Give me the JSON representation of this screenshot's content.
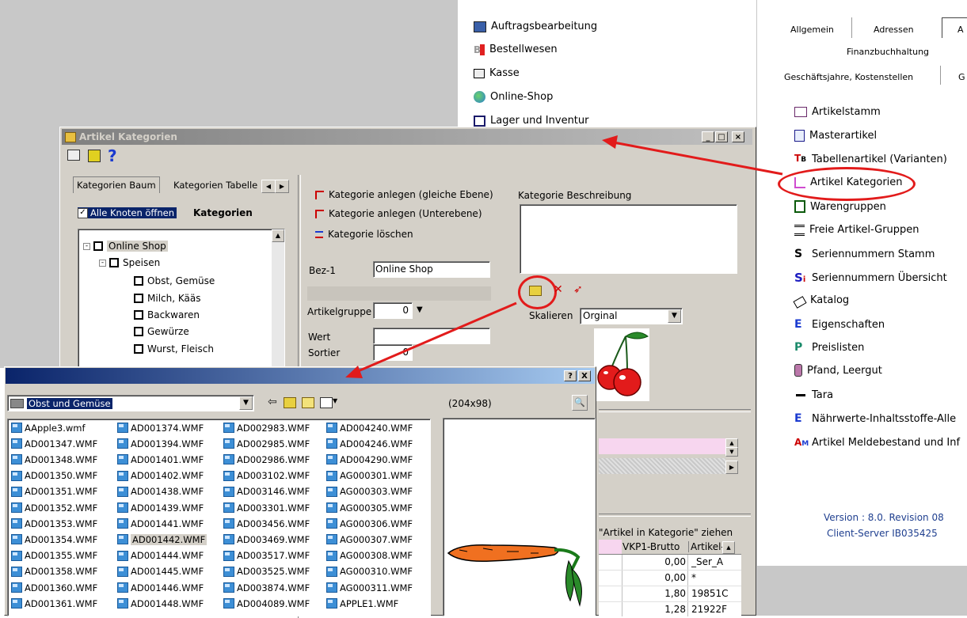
{
  "main_menu": {
    "items": [
      {
        "label": "Auftragsbearbeitung",
        "icon": "calculator-icon"
      },
      {
        "label": "Bestellwesen",
        "icon": "b-red-icon"
      },
      {
        "label": "Kasse",
        "icon": "cash-register-icon"
      },
      {
        "label": "Online-Shop",
        "icon": "globe-icon"
      },
      {
        "label": "Lager und Inventur",
        "icon": "warehouse-icon"
      }
    ]
  },
  "top_tabs": {
    "allgemein": "Allgemein",
    "adressen": "Adressen",
    "partial": "A",
    "finanz": "Finanzbuchhaltung",
    "geschaeft": "Geschäftsjahre, Kostenstellen",
    "partial2": "G"
  },
  "right_menu": {
    "items": [
      {
        "label": "Artikelstamm"
      },
      {
        "label": "Masterartikel"
      },
      {
        "label": "Tabellenartikel (Varianten)"
      },
      {
        "label": "Artikel Kategorien"
      },
      {
        "label": "Warengruppen"
      },
      {
        "label": "Freie Artikel-Gruppen"
      },
      {
        "label": "Seriennummern Stamm"
      },
      {
        "label": "Seriennummern Übersicht"
      },
      {
        "label": "Katalog"
      },
      {
        "label": "Eigenschaften"
      },
      {
        "label": "Preislisten"
      },
      {
        "label": "Pfand, Leergut"
      },
      {
        "label": "Tara"
      },
      {
        "label": "Nährwerte-Inhaltsstoffe-Alle"
      },
      {
        "label": "Artikel Meldebestand und Inf"
      }
    ],
    "version": "Version : 8.0. Revision 08",
    "server": "Client-Server  IB035425"
  },
  "kat_window": {
    "title": "Artikel Kategorien",
    "tab_baum": "Kategorien Baum",
    "tab_tabelle": "Kategorien Tabelle",
    "checkbox_label": "Alle Knoten öffnen",
    "kategorien_header": "Kategorien",
    "tree": [
      {
        "label": "Online Shop"
      },
      {
        "label": "Speisen"
      },
      {
        "label": "Obst, Gemüse"
      },
      {
        "label": "Milch, Kääs"
      },
      {
        "label": "Backwaren"
      },
      {
        "label": "Gewürze"
      },
      {
        "label": "Wurst, Fleisch"
      }
    ],
    "actions": {
      "anlegen_gleich": "Kategorie anlegen (gleiche Ebene)",
      "anlegen_unter": "Kategorie anlegen (Unterebene)",
      "loeschen": "Kategorie löschen"
    },
    "beschreibung_label": "Kategorie Beschreibung",
    "bez_label": "Bez-1",
    "bez_value": "Online Shop",
    "artikelgruppe_label": "Artikelgruppe",
    "artikelgruppe_value": "0",
    "wert_label": "Wert",
    "sortier_label": "Sortier",
    "sortier_value": "0",
    "skalieren_label": "Skalieren",
    "skalieren_value": "Orginal",
    "drag_hint": "\"Artikel in Kategorie\" ziehen",
    "grid_headers": [
      "VKP1-Brutto",
      "Artikel-I"
    ],
    "grid_rows": [
      {
        "price": "0,00",
        "code": "_Ser_A"
      },
      {
        "price": "0,00",
        "code": "*"
      },
      {
        "price": "1,80",
        "code": "19851C"
      },
      {
        "price": "1,28",
        "code": "21922F"
      }
    ]
  },
  "file_dialog": {
    "folder": "Obst und Gemüse",
    "dimensions": "(204x98)",
    "help_btn": "?",
    "close_btn": "X",
    "columns": [
      [
        "AApple3.wmf",
        "AD001347.WMF",
        "AD001348.WMF",
        "AD001350.WMF",
        "AD001351.WMF",
        "AD001352.WMF",
        "AD001353.WMF",
        "AD001354.WMF",
        "AD001355.WMF",
        "AD001358.WMF",
        "AD001360.WMF",
        "AD001361.WMF"
      ],
      [
        "AD001374.WMF",
        "AD001394.WMF",
        "AD001401.WMF",
        "AD001402.WMF",
        "AD001438.WMF",
        "AD001439.WMF",
        "AD001441.WMF",
        "AD001442.WMF",
        "AD001444.WMF",
        "AD001445.WMF",
        "AD001446.WMF",
        "AD001448.WMF"
      ],
      [
        "AD002983.WMF",
        "AD002985.WMF",
        "AD002986.WMF",
        "AD003102.WMF",
        "AD003146.WMF",
        "AD003301.WMF",
        "AD003456.WMF",
        "AD003469.WMF",
        "AD003517.WMF",
        "AD003525.WMF",
        "AD003874.WMF",
        "AD004089.WMF"
      ],
      [
        "AD004240.WMF",
        "AD004246.WMF",
        "AD004290.WMF",
        "AG000301.WMF",
        "AG000303.WMF",
        "AG000305.WMF",
        "AG000306.WMF",
        "AG000307.WMF",
        "AG000308.WMF",
        "AG000310.WMF",
        "AG000311.WMF",
        "APPLE1.WMF"
      ]
    ],
    "selected": "AD001442.WMF"
  },
  "colors": {
    "annotation_red": "#e21b1b",
    "titlebar_inactive": "#808080",
    "selection": "#0a246a",
    "version_blue": "#1f3f8f"
  }
}
